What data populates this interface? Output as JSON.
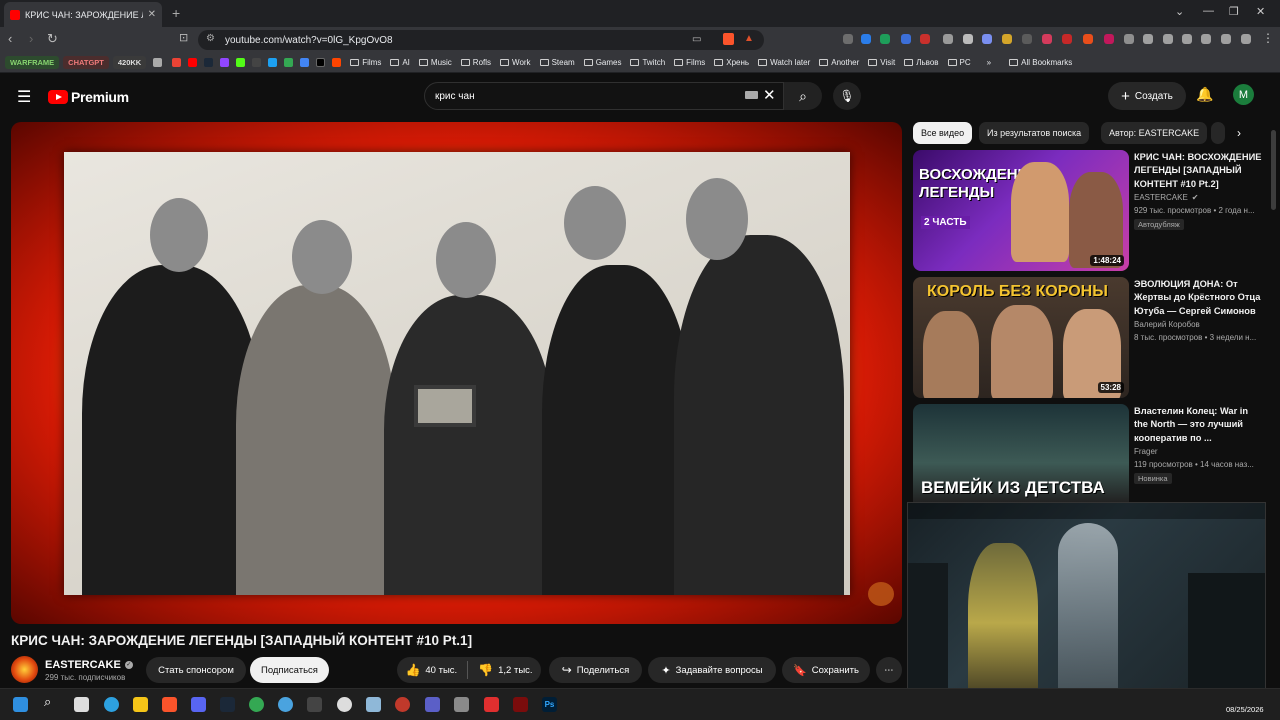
{
  "browser": {
    "tab_title": "КРИС ЧАН: ЗАРОЖДЕНИЕ ЛЕГЕ",
    "url": "youtube.com/watch?v=0lG_KpgOvO8",
    "bookmark_chips": [
      "WARFRAME",
      "CHATGPT",
      "420KK"
    ],
    "bookmarks": [
      "Films",
      "AI",
      "Music",
      "Rofls",
      "Work",
      "Steam",
      "Games",
      "Twitch",
      "Films",
      "Хрень",
      "Watch later",
      "Another",
      "Visit",
      "Львов",
      "PC"
    ],
    "all_bookmarks": "All Bookmarks"
  },
  "youtube": {
    "logo_text": "Premium",
    "search_value": "крис чан",
    "create_label": "Создать",
    "avatar_letter": "M"
  },
  "video": {
    "title": "КРИС ЧАН: ЗАРОЖДЕНИЕ ЛЕГЕНДЫ [ЗАПАДНЫЙ КОНТЕНТ #10 Pt.1]",
    "channel": "EASTERCAKE",
    "subscribers": "299 тыс. подписчиков",
    "sponsor_label": "Стать спонсором",
    "subscribe_label": "Подписаться",
    "likes": "40 тыс.",
    "dislikes": "1,2 тыс.",
    "share_label": "Поделиться",
    "ask_label": "Задавайте вопросы",
    "save_label": "Сохранить"
  },
  "sidebar": {
    "chips": [
      "Все видео",
      "Из результатов поиска",
      "Автор: EASTERCAKE"
    ],
    "videos": [
      {
        "title": "КРИС ЧАН: ВОСХОЖДЕНИЕ ЛЕГЕНДЫ [ЗАПАДНЫЙ КОНТЕНТ #10 Pt.2]",
        "channel": "EASTERCAKE",
        "meta": "929 тыс. просмотров • 2 года н...",
        "badge": "Автодубляж",
        "duration": "1:48:24",
        "thumb_text": "ВОСХОЖДЕНИЕ ЛЕГЕНДЫ",
        "thumb_sub": "2 ЧАСТЬ"
      },
      {
        "title": "ЭВОЛЮЦИЯ ДОНА: От Жертвы до Крёстного Отца Ютуба — Сергей Симонов",
        "channel": "Валерий Коробов",
        "meta": "8 тыс. просмотров • 3 недели н...",
        "duration": "53:28",
        "thumb_text": "КОРОЛЬ БЕЗ КОРОНЫ"
      },
      {
        "title": "Властелин Колец: War in the North — это лучший кооператив по ...",
        "channel": "Frager",
        "meta": "119 просмотров • 14 часов наз...",
        "badge": "Новинка",
        "thumb_text": "ВЕМЕЙК ИЗ ДЕТСТВА"
      }
    ]
  },
  "taskbar": {
    "date": "08/25/2026"
  },
  "colors": {
    "yt_red": "#ff0000",
    "bg": "#0f0f0f",
    "chip": "#272727"
  }
}
